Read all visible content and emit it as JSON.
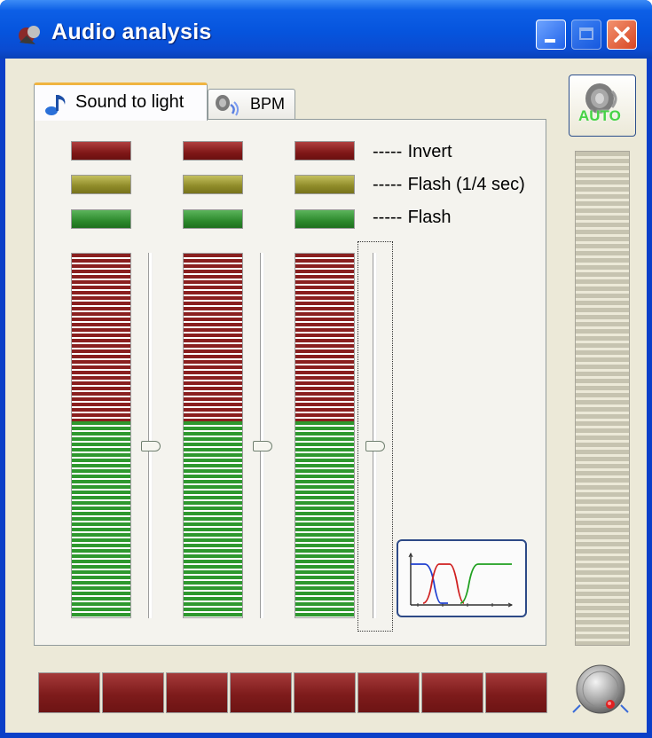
{
  "window": {
    "title": "Audio analysis"
  },
  "titlebar_buttons": [
    "minimize",
    "maximize",
    "close"
  ],
  "tabs": [
    {
      "label": "Sound to light",
      "icon": "music-note-icon",
      "active": true
    },
    {
      "label": "BPM",
      "icon": "speaker-icon",
      "active": false
    }
  ],
  "legend": [
    {
      "dashes": "-----",
      "label": "Invert",
      "color": "#8a1f1f"
    },
    {
      "dashes": "-----",
      "label": "Flash (1/4 sec)",
      "color": "#8e8a28"
    },
    {
      "dashes": "-----",
      "label": "Flash",
      "color": "#2d8a2d"
    }
  ],
  "meters": [
    {
      "red_fraction": 0.46,
      "green_fraction": 0.54,
      "slider_level": 0.47
    },
    {
      "red_fraction": 0.46,
      "green_fraction": 0.54,
      "slider_level": 0.47
    },
    {
      "red_fraction": 0.46,
      "green_fraction": 0.54,
      "slider_level": 0.47
    }
  ],
  "auto_button": {
    "label": "AUTO",
    "icon": "speaker-auto-icon"
  },
  "filter_button": {
    "icon": "filter-curves-icon"
  },
  "flash_buttons_count": 8,
  "side_meter_level": 0,
  "colors": {
    "red": "#8a1f1f",
    "yellow": "#8e8a28",
    "green": "#2e982e",
    "titlebar": "#0654dd"
  }
}
